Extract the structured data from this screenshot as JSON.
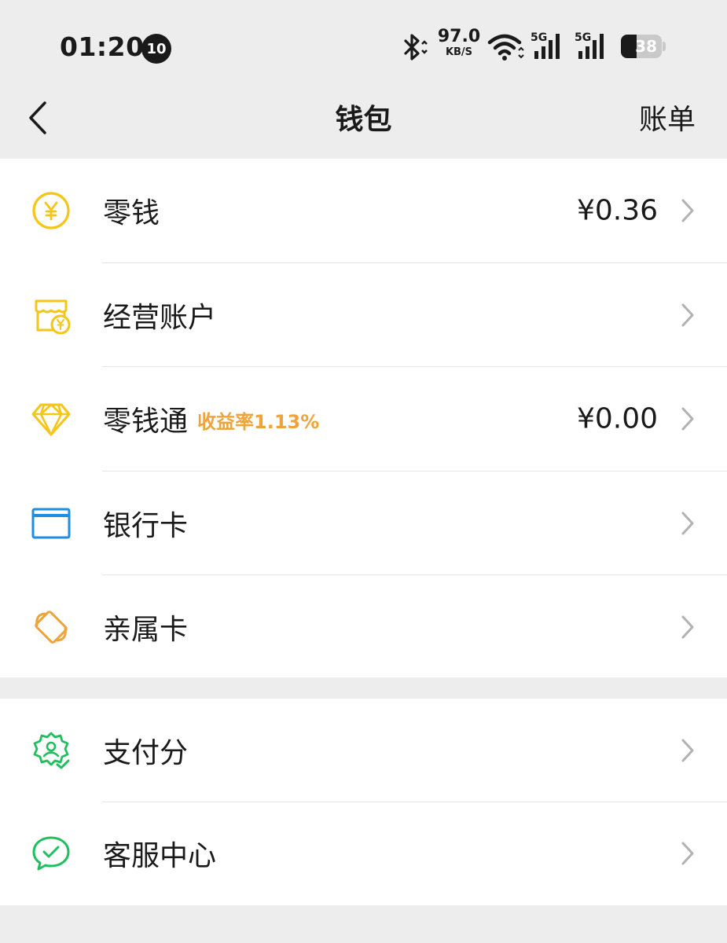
{
  "status_bar": {
    "time": "01:20",
    "notification_count": "10",
    "net_speed_value": "97.0",
    "net_speed_unit": "KB/S",
    "signal1_label": "5G",
    "signal2_label": "5G",
    "battery_level": "38",
    "battery_fraction": 0.38
  },
  "header": {
    "title": "钱包",
    "right_action": "账单"
  },
  "wallet_items": [
    {
      "label": "零钱",
      "amount": "¥0.36",
      "icon": "yuan-coin-icon"
    },
    {
      "label": "经营账户",
      "amount": "",
      "icon": "shop-account-icon"
    },
    {
      "label": "零钱通",
      "tag": "收益率1.13%",
      "amount": "¥0.00",
      "icon": "diamond-icon"
    },
    {
      "label": "银行卡",
      "amount": "",
      "icon": "bank-card-icon"
    },
    {
      "label": "亲属卡",
      "amount": "",
      "icon": "family-card-icon"
    }
  ],
  "service_items": [
    {
      "label": "支付分",
      "icon": "pay-score-icon"
    },
    {
      "label": "客服中心",
      "icon": "customer-service-icon"
    }
  ],
  "colors": {
    "background": "#ededed",
    "card": "#ffffff",
    "yellow": "#f5c518",
    "blue": "#1f8ee0",
    "orange": "#f0a33a",
    "green": "#1fbf5f",
    "chevron": "#b2b2b2"
  }
}
